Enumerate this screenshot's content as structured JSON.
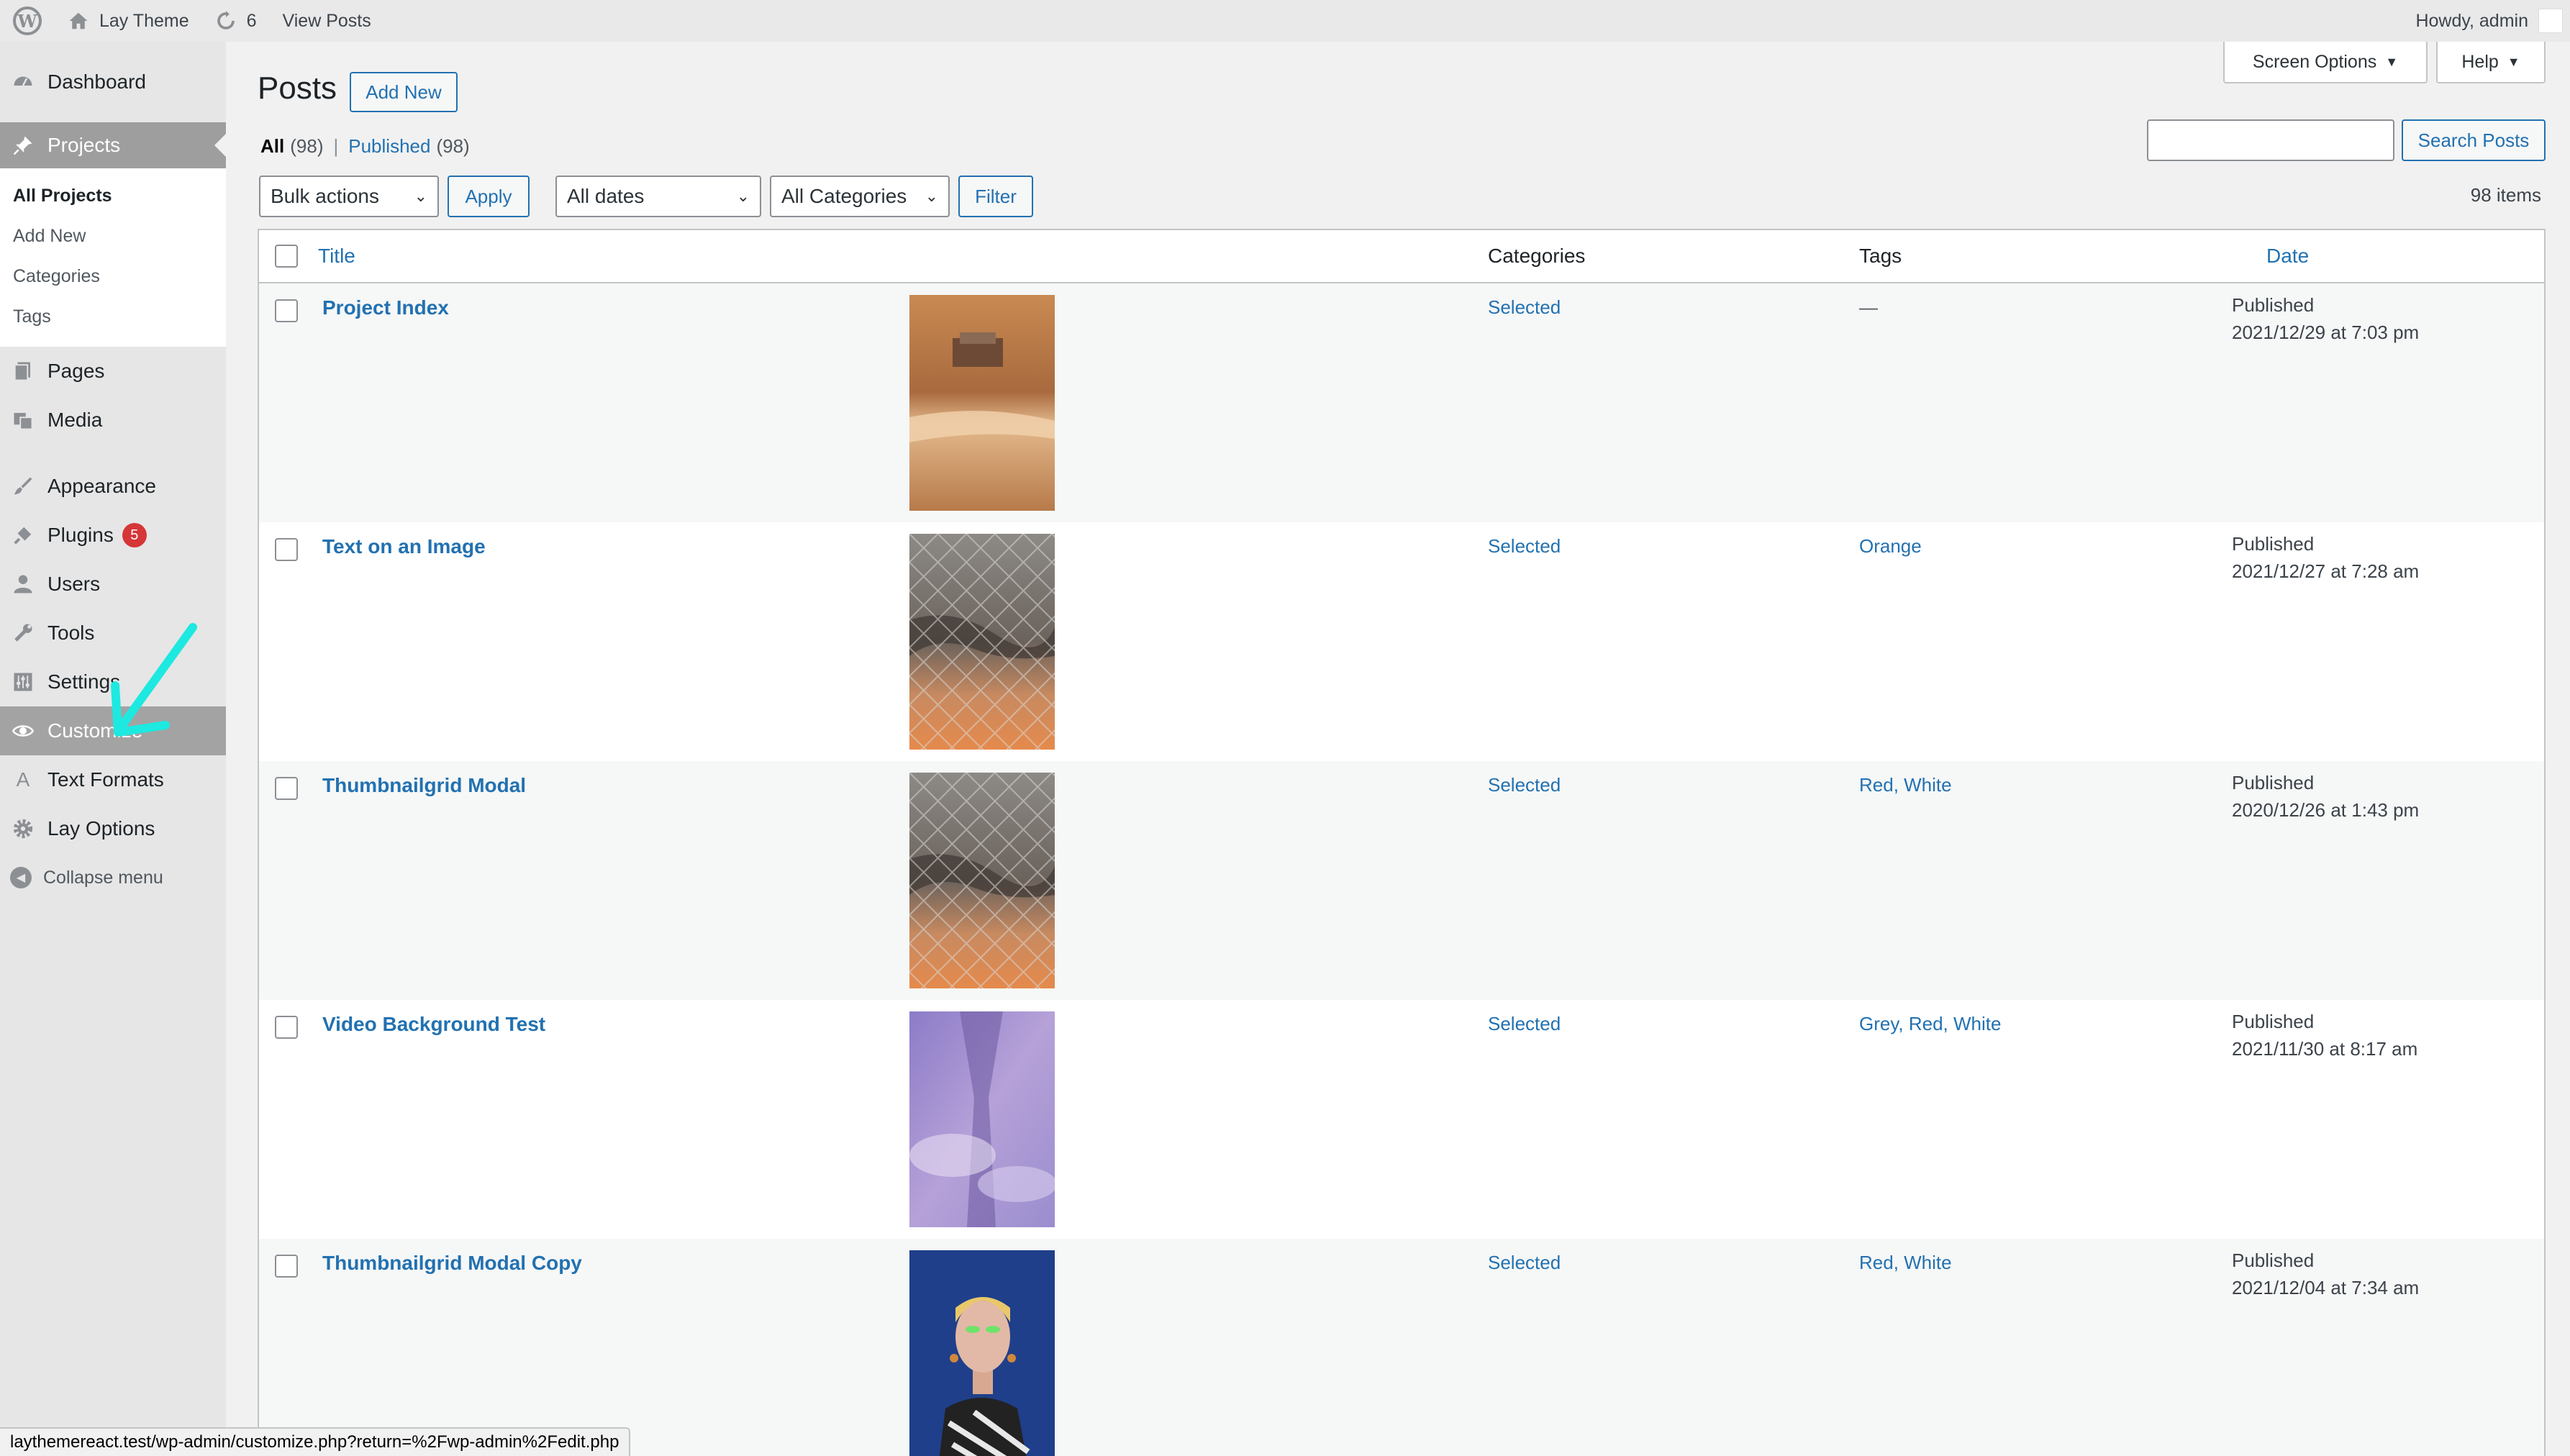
{
  "adminbar": {
    "site_name": "Lay Theme",
    "updates_count": "6",
    "view_posts": "View Posts",
    "howdy": "Howdy, admin"
  },
  "sidebar": {
    "dashboard": "Dashboard",
    "projects": "Projects",
    "submenu": [
      "All Projects",
      "Add New",
      "Categories",
      "Tags"
    ],
    "pages": "Pages",
    "media": "Media",
    "appearance": "Appearance",
    "plugins": "Plugins",
    "plugins_badge": "5",
    "users": "Users",
    "tools": "Tools",
    "settings": "Settings",
    "customize": "Customize",
    "text_formats": "Text Formats",
    "lay_options": "Lay Options",
    "collapse": "Collapse menu"
  },
  "header": {
    "title": "Posts",
    "add_new": "Add New",
    "screen_options": "Screen Options",
    "help": "Help",
    "search_button": "Search Posts"
  },
  "views": {
    "all_label": "All",
    "all_count": "(98)",
    "separator": "|",
    "published_label": "Published",
    "published_count": "(98)"
  },
  "filters": {
    "bulk_actions": "Bulk actions",
    "apply": "Apply",
    "dates": "All dates",
    "categories": "All Categories",
    "filter": "Filter",
    "items_count": "98 items"
  },
  "table": {
    "headers": {
      "title": "Title",
      "categories": "Categories",
      "tags": "Tags",
      "date": "Date"
    },
    "rows": [
      {
        "title": "Project Index",
        "category": "Selected",
        "tags": "—",
        "status": "Published",
        "date": "2021/12/29 at 7:03 pm",
        "thumb": "car-in-desert"
      },
      {
        "title": "Text on an Image",
        "category": "Selected",
        "tags": "Orange",
        "status": "Published",
        "date": "2021/12/27 at 7:28 am",
        "thumb": "fence-sunset"
      },
      {
        "title": "Thumbnailgrid Modal",
        "category": "Selected",
        "tags": "Red, White",
        "status": "Published",
        "date": "2020/12/26 at 1:43 pm",
        "thumb": "fence-sunset"
      },
      {
        "title": "Video Background Test",
        "category": "Selected",
        "tags": "Grey, Red, White",
        "status": "Published",
        "date": "2021/11/30 at 8:17 am",
        "thumb": "purple-sky"
      },
      {
        "title": "Thumbnailgrid Modal Copy",
        "category": "Selected",
        "tags": "Red, White",
        "status": "Published",
        "date": "2021/12/04 at 7:34 am",
        "thumb": "portrait"
      }
    ]
  },
  "statusbar": {
    "url": "laythemereact.test/wp-admin/customize.php?return=%2Fwp-admin%2Fedit.php"
  },
  "colors": {
    "link": "#2271b1",
    "annotation_arrow": "#1de9e0",
    "badge": "#d63638"
  }
}
